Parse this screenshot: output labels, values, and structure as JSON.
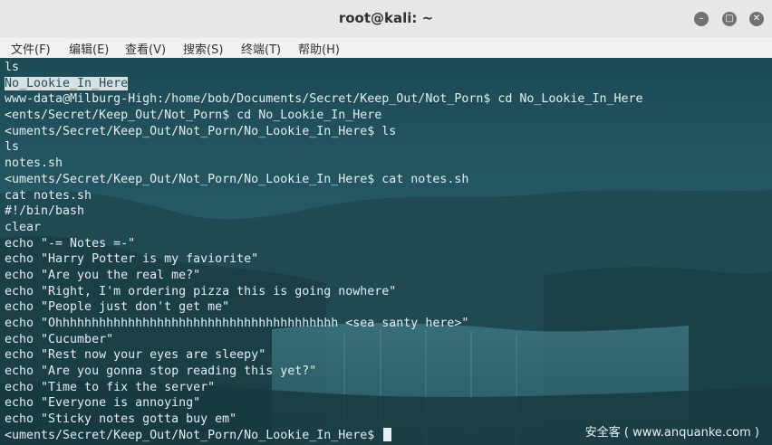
{
  "window": {
    "title": "root@kali: ~",
    "minimize_icon": "minimize-icon",
    "maximize_icon": "maximize-icon",
    "close_icon": "close-icon"
  },
  "menu": [
    {
      "label": "文件(F)"
    },
    {
      "label": "编辑(E)"
    },
    {
      "label": "查看(V)"
    },
    {
      "label": "搜索(S)"
    },
    {
      "label": "终端(T)"
    },
    {
      "label": "帮助(H)"
    }
  ],
  "terminal": {
    "lines": [
      "ls",
      "No_Lookie_In_Here",
      "www-data@Milburg-High:/home/bob/Documents/Secret/Keep_Out/Not_Porn$ cd No_Lookie_In_Here",
      "<ents/Secret/Keep_Out/Not_Porn$ cd No_Lookie_In_Here",
      "<uments/Secret/Keep_Out/Not_Porn/No_Lookie_In_Here$ ls",
      "ls",
      "notes.sh",
      "<uments/Secret/Keep_Out/Not_Porn/No_Lookie_In_Here$ cat notes.sh",
      "cat notes.sh",
      "#!/bin/bash",
      "clear",
      "echo \"-= Notes =-\"",
      "echo \"Harry Potter is my faviorite\"",
      "echo \"Are you the real me?\"",
      "echo \"Right, I'm ordering pizza this is going nowhere\"",
      "echo \"People just don't get me\"",
      "echo \"Ohhhhhhhhhhhhhhhhhhhhhhhhhhhhhhhhhhhhhhh <sea santy here>\"",
      "echo \"Cucumber\"",
      "echo \"Rest now your eyes are sleepy\"",
      "echo \"Are you gonna stop reading this yet?\"",
      "echo \"Time to fix the server\"",
      "echo \"Everyone is annoying\"",
      "echo \"Sticky notes gotta buy em\"",
      "<uments/Secret/Keep_Out/Not_Porn/No_Lookie_In_Here$ "
    ],
    "highlighted_line": 1
  },
  "watermark": "安全客 ( www.anquanke.com )",
  "colors": {
    "terminal_bg": "#214e58",
    "text": "#e6eef0",
    "highlight_bg": "#d9e1e3"
  }
}
